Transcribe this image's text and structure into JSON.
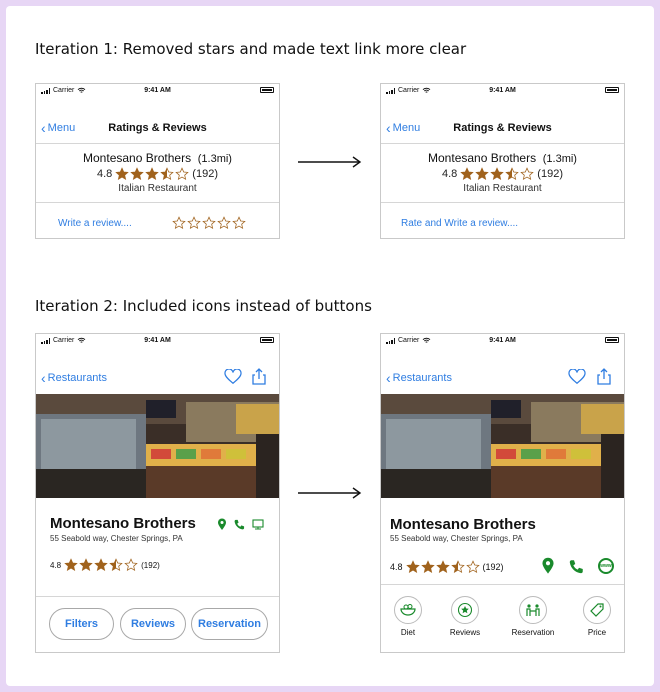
{
  "colors": {
    "link": "#2f7de1",
    "star": "#a0621c",
    "green": "#1a8a2c"
  },
  "headings": {
    "iteration1": "Iteration 1: Removed stars and made text link more clear",
    "iteration2": "Iteration 2: Included icons instead of buttons"
  },
  "status": {
    "carrier": "Carrier",
    "time": "9:41 AM"
  },
  "iter1": {
    "back_label": "Menu",
    "title": "Ratings & Reviews",
    "restaurant": "Montesano Brothers",
    "distance": "(1.3mi)",
    "rating": "4.8",
    "rating_stars": 3.5,
    "review_count": "(192)",
    "category": "Italian Restaurant",
    "before_link": "Write a review....",
    "after_link": "Rate and Write a review...."
  },
  "iter2": {
    "back_label": "Restaurants",
    "restaurant": "Montesano Brothers",
    "address": "55 Seabold way, Chester Springs, PA",
    "rating": "4.8",
    "review_count": "(192)",
    "buttons": {
      "filters": "Filters",
      "reviews": "Reviews",
      "reservation": "Reservation"
    },
    "tabs": {
      "diet": "Diet",
      "reviews": "Reviews",
      "reservation": "Reservation",
      "price": "Price"
    },
    "www": "www"
  }
}
